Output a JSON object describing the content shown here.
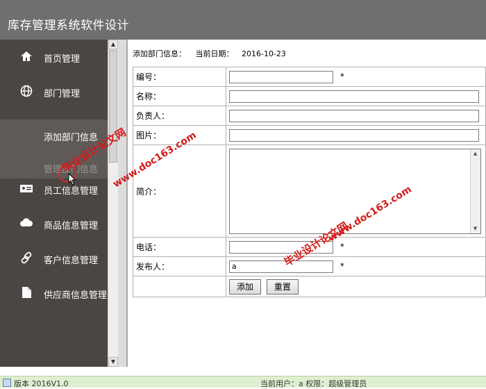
{
  "header": {
    "title": "库存管理系统软件设计"
  },
  "sidebar": {
    "items": [
      {
        "label": "首页管理",
        "icon": "home-icon"
      },
      {
        "label": "部门管理",
        "icon": "globe-icon"
      },
      {
        "label": "员工信息管理",
        "icon": "id-card-icon"
      },
      {
        "label": "商品信息管理",
        "icon": "cloud-icon"
      },
      {
        "label": "客户信息管理",
        "icon": "link-icon"
      },
      {
        "label": "供应商信息管理",
        "icon": "file-icon"
      }
    ],
    "sub_items": [
      {
        "label": "添加部门信息",
        "state": "active"
      },
      {
        "label": "管理部门信息",
        "state": "inactive"
      }
    ]
  },
  "content": {
    "heading": "添加部门信息：",
    "date_label": "当前日期：",
    "date_value": "2016-10-23"
  },
  "form": {
    "fields": {
      "code": {
        "label": "编号：",
        "value": "",
        "required": "*"
      },
      "name": {
        "label": "名称：",
        "value": ""
      },
      "manager": {
        "label": "负责人：",
        "value": ""
      },
      "image": {
        "label": "图片：",
        "value": ""
      },
      "intro": {
        "label": "简介：",
        "value": ""
      },
      "phone": {
        "label": "电话：",
        "value": "",
        "required": "*"
      },
      "publisher": {
        "label": "发布人：",
        "value": "a",
        "required": "*"
      }
    },
    "buttons": {
      "add": "添加",
      "reset": "重置"
    }
  },
  "watermarks": {
    "text_cn": "毕业设计论文网",
    "text_url": "www.doc163.com"
  },
  "status_bar": {
    "version": "版本 2016V1.0",
    "user_info": "当前用户：a 权限：超级管理员"
  },
  "colors": {
    "header_bg": "#6f6f6f",
    "sidebar_bg": "#4b4643",
    "watermark": "#d31a1a",
    "status_bg": "#dff0d0"
  }
}
